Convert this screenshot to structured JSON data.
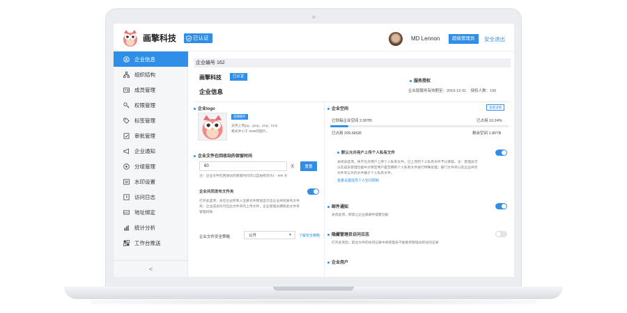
{
  "header": {
    "brand": "画擎科技",
    "verified": "已认证",
    "username": "MD Lennon",
    "role": "超级管理员",
    "logout": "安全退出"
  },
  "sidebar": {
    "items": [
      {
        "label": "企业信息",
        "icon": "building-icon"
      },
      {
        "label": "组织结构",
        "icon": "org-tree-icon"
      },
      {
        "label": "成员管理",
        "icon": "id-card-icon"
      },
      {
        "label": "权限管理",
        "icon": "key-icon"
      },
      {
        "label": "标签管理",
        "icon": "tag-icon"
      },
      {
        "label": "审批管理",
        "icon": "approval-icon"
      },
      {
        "label": "企业通知",
        "icon": "megaphone-icon"
      },
      {
        "label": "分组管理",
        "icon": "group-icon"
      },
      {
        "label": "水印设置",
        "icon": "watermark-icon"
      },
      {
        "label": "访问日志",
        "icon": "clock-icon"
      },
      {
        "label": "地址绑定",
        "icon": "mac-icon"
      },
      {
        "label": "统计分析",
        "icon": "chart-icon"
      },
      {
        "label": "工作台推送",
        "icon": "grid-icon"
      }
    ],
    "collapse": "<"
  },
  "content": {
    "enterprise_id": "企业编号 162",
    "company_name": "画擎科技",
    "company_badge": "已认证",
    "section_title": "企业信息",
    "service": {
      "title": "服务授权",
      "expiry": "企业版服务有效期至：2019-12-31",
      "licenses": "授权人数：150"
    },
    "logo": {
      "title": "企业logo",
      "pick": "选择图片",
      "hint1": "支持上传jpg，jpeg，png，bmp",
      "hint2": "格式并小于 5MB的图片。"
    },
    "recycle": {
      "title": "企业文件在回收站的保留时间",
      "value": "60",
      "unit": "天",
      "reset": "重置",
      "note": "注：企业文件在回收站的保留时间可以自由修改为1 - 999 天"
    },
    "shared_folder": {
      "title": "企业共同发布文件夹",
      "enabled": true,
      "desc1": "打开此选项，会在企业所有人全部文件频道显示出企业共同发布文件",
      "desc2": "夹；企业成员均可在此文件夹内上传文件，企业管理员拥有此文件夹",
      "desc3": "管理权限"
    },
    "policy": {
      "label": "企业文件安全策略",
      "value": "公开",
      "link": "了解安全策略"
    },
    "space": {
      "title": "企业空间",
      "detail": "查看详情",
      "allocated": "已划每企业空间 2.00TB",
      "used_pct_label": "已占用  10.24%",
      "used_fraction": 0.1024,
      "used": "已占用   209.68GB",
      "remaining": "剩余空间  1.80TB"
    },
    "personal": {
      "title": "默认允许用户上传个人私有文件",
      "enabled": true,
      "desc1": "关闭该选项，将不允许用户上传个人私有文件，已上传的个人私有文件予以保留。注：管理员可",
      "desc2": "以在成员管理功能中对特定用户是否拥有个人私有文件进行特殊处理；部门文件夹以及企业共享",
      "desc3": "文件夹以外的文件属于个人私有文件。",
      "link": "批量设置成员个人空间限制"
    },
    "mail": {
      "title": "邮件通知",
      "enabled": true,
      "desc": "关闭此项，即禁止企业级邮件提醒功能"
    },
    "hide_admin": {
      "title": "隐藏管理员访问日志",
      "enabled": false,
      "desc": "打开此项后，前台文件的访问记录中将管理员不能看到管理员的访问记录"
    },
    "users": {
      "title": "企业用户"
    }
  },
  "colors": {
    "accent": "#2f8fe8",
    "sidebar_bg": "#f5f6f8"
  }
}
